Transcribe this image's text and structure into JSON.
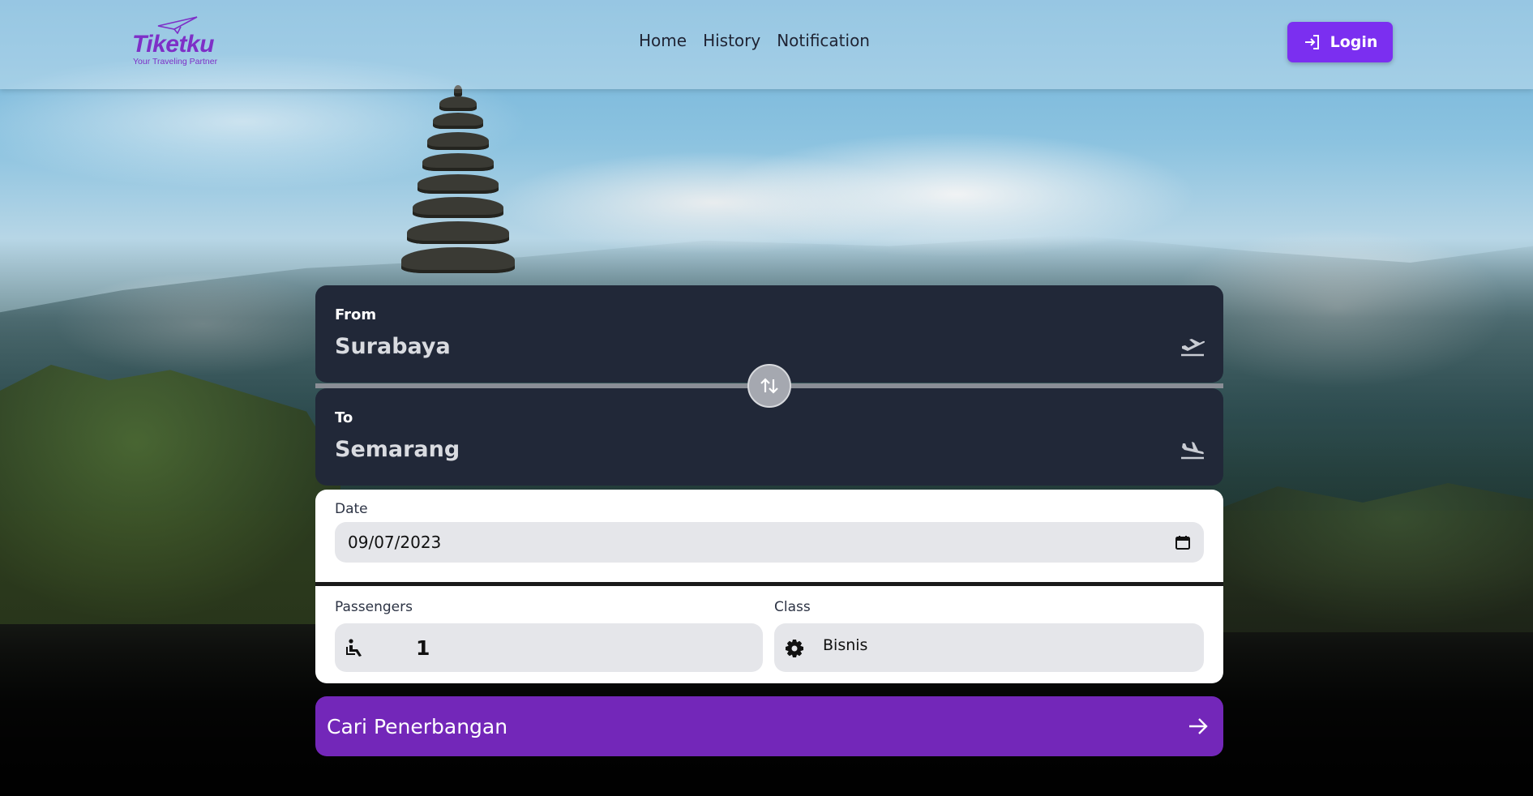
{
  "brand": {
    "name": "Tiketku",
    "tagline": "Your Traveling Partner",
    "color": "#7e2fc7"
  },
  "nav": {
    "items": [
      "Home",
      "History",
      "Notification"
    ]
  },
  "header": {
    "login_label": "Login",
    "login_color": "#7b2ff0"
  },
  "search": {
    "from_label": "From",
    "from_value": "Surabaya",
    "to_label": "To",
    "to_value": "Semarang",
    "date_label": "Date",
    "date_value": "09/07/2023",
    "passengers_label": "Passengers",
    "passengers_value": "1",
    "class_label": "Class",
    "class_value": "Bisnis",
    "submit_label": "Cari Penerbangan",
    "submit_color": "#7327b9"
  },
  "icons": {
    "takeoff": "flight-takeoff-icon",
    "landing": "flight-land-icon",
    "swap": "swap-vertical-icon",
    "calendar": "calendar-icon",
    "passenger": "seat-passenger-icon",
    "class": "gear-icon",
    "arrow": "arrow-right-icon",
    "login": "login-icon"
  }
}
